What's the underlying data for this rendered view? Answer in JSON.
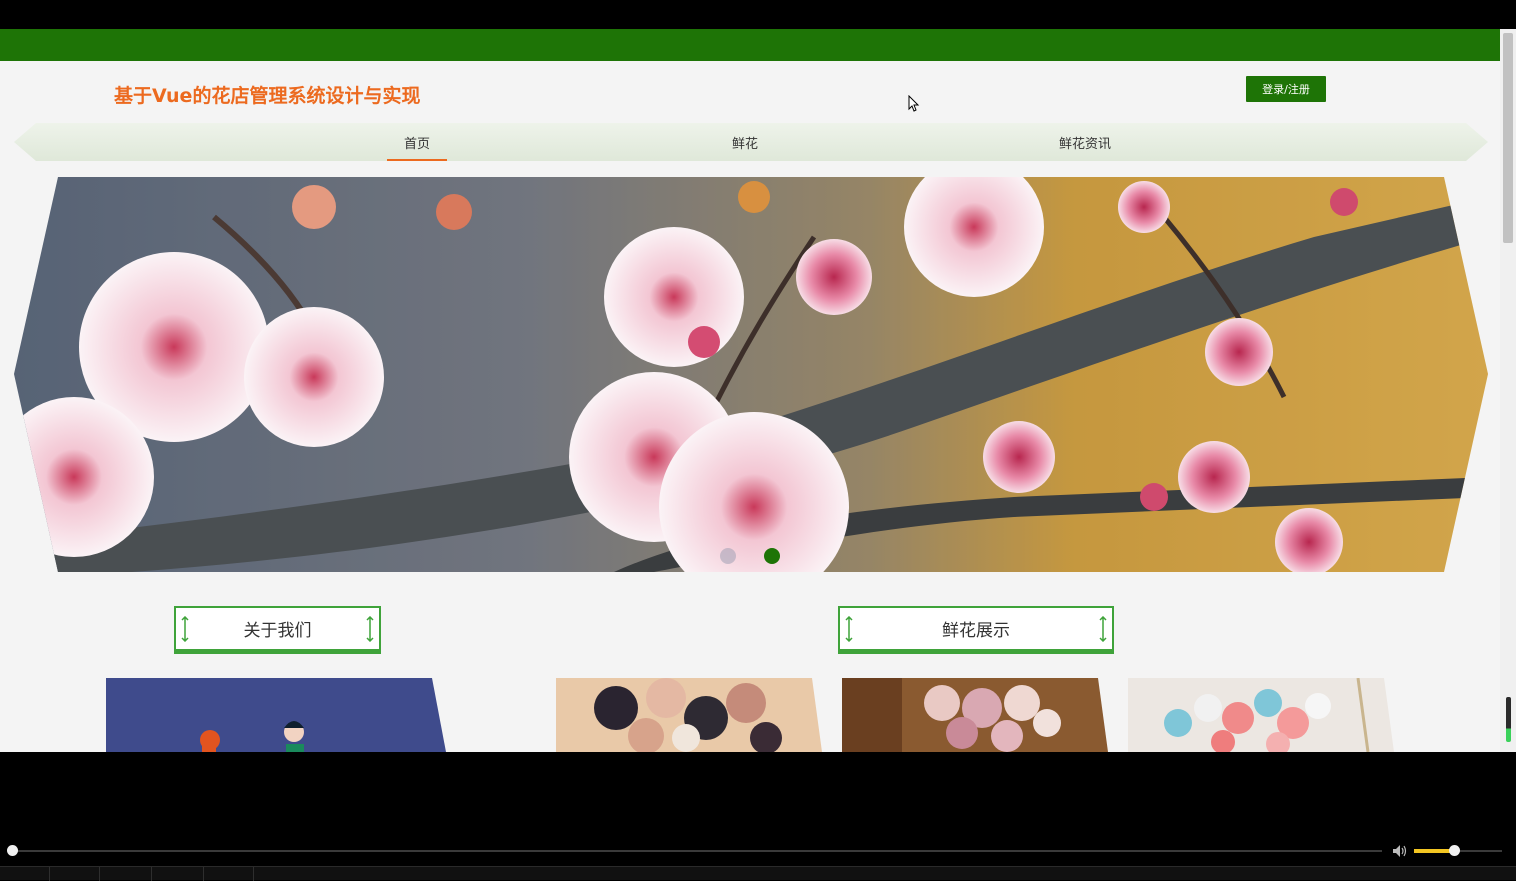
{
  "header": {
    "site_title": "基于Vue的花店管理系统设计与实现",
    "login_label": "登录/注册"
  },
  "nav": {
    "items": [
      {
        "label": "首页",
        "active": true
      },
      {
        "label": "鲜花",
        "active": false
      },
      {
        "label": "鲜花资讯",
        "active": false
      }
    ]
  },
  "banner": {
    "slide_count": 2,
    "active_slide": 2
  },
  "sections": {
    "about_title": "关于我们",
    "flowers_title": "鲜花展示"
  },
  "colors": {
    "brand_green": "#1e7406",
    "title_orange": "#ec6a1f",
    "section_border": "#3fa33a",
    "volume_fill": "#f3c622"
  },
  "player": {
    "progress": 0.0,
    "volume": 0.45
  }
}
